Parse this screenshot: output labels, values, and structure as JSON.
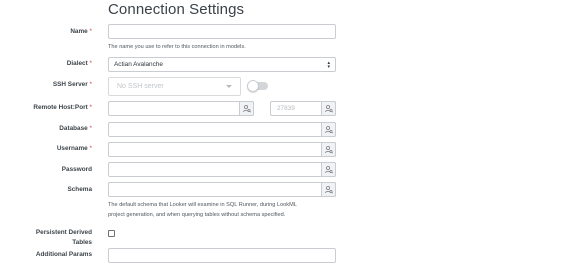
{
  "page": {
    "title": "Connection Settings"
  },
  "fields": {
    "name": {
      "label": "Name",
      "required_mark": "*",
      "value": "",
      "help": "The name you use to refer to this connection in models."
    },
    "dialect": {
      "label": "Dialect",
      "required_mark": "*",
      "value": "Actian Avalanche"
    },
    "ssh_server": {
      "label": "SSH Server",
      "required_mark": "*",
      "placeholder": "No SSH server",
      "toggle_on": false
    },
    "remote_host": {
      "label": "Remote Host:Port",
      "required_mark": "*",
      "host_value": "",
      "port_placeholder": "27839"
    },
    "database": {
      "label": "Database",
      "required_mark": "*",
      "value": ""
    },
    "username": {
      "label": "Username",
      "required_mark": "*",
      "value": ""
    },
    "password": {
      "label": "Password",
      "value": ""
    },
    "schema": {
      "label": "Schema",
      "value": "",
      "help_line1": "The default schema that Looker will examine in SQL Runner, during LookML",
      "help_line2": "project generation, and when querying tables without schema specified."
    },
    "pdt": {
      "label_line1": "Persistent Derived",
      "label_line2": "Tables",
      "checked": false
    },
    "additional_params": {
      "label": "Additional Params",
      "value": ""
    }
  },
  "icons": {
    "lookup": "user-lookup-icon",
    "dropdown": "chevron-down-icon",
    "select_arrows": "up-down-arrows-icon"
  },
  "colors": {
    "required": "#c2434a",
    "border": "#c9ccd0",
    "title": "#3b4248"
  }
}
